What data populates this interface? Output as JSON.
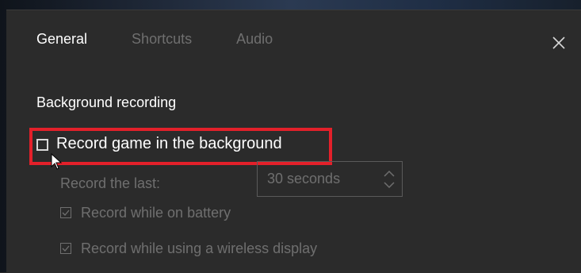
{
  "tabs": [
    {
      "label": "General",
      "active": true
    },
    {
      "label": "Shortcuts",
      "active": false
    },
    {
      "label": "Audio",
      "active": false
    }
  ],
  "close_icon": "close-icon",
  "section": {
    "title": "Background recording"
  },
  "main_option": {
    "label": "Record game in the background",
    "checked": false
  },
  "record_last": {
    "label": "Record the last:",
    "value": "30 seconds"
  },
  "sub_options": [
    {
      "label": "Record while on battery",
      "checked": true
    },
    {
      "label": "Record while using a wireless display",
      "checked": true
    }
  ],
  "colors": {
    "background": "#2b2b2b",
    "text_active": "#ffffff",
    "text_disabled": "#6f6f6f",
    "highlight": "#e3202a"
  }
}
